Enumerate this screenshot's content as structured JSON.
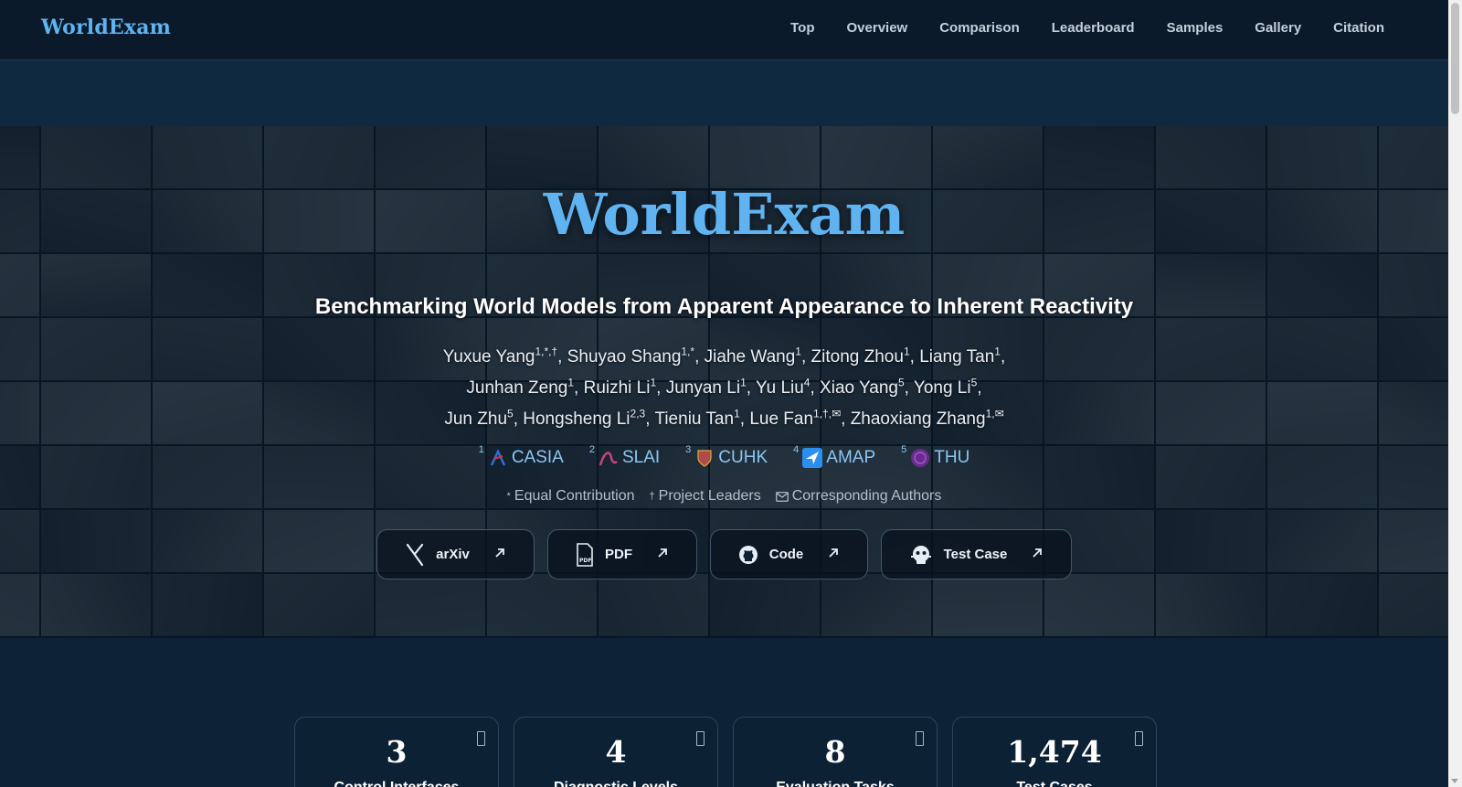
{
  "nav": {
    "brand": "WorldExam",
    "links": [
      "Top",
      "Overview",
      "Comparison",
      "Leaderboard",
      "Samples",
      "Gallery",
      "Citation"
    ]
  },
  "hero": {
    "title": "WorldExam",
    "subtitle": "Benchmarking World Models from Apparent Appearance to Inherent Reactivity",
    "author_lines": [
      [
        {
          "name": "Yuxue Yang",
          "sup": "1,*,†"
        },
        {
          "name": "Shuyao Shang",
          "sup": "1,*"
        },
        {
          "name": "Jiahe Wang",
          "sup": "1"
        },
        {
          "name": "Zitong Zhou",
          "sup": "1"
        },
        {
          "name": "Liang Tan",
          "sup": "1"
        }
      ],
      [
        {
          "name": "Junhan Zeng",
          "sup": "1"
        },
        {
          "name": "Ruizhi Li",
          "sup": "1"
        },
        {
          "name": "Junyan Li",
          "sup": "1"
        },
        {
          "name": "Yu Liu",
          "sup": "4"
        },
        {
          "name": "Xiao Yang",
          "sup": "5"
        },
        {
          "name": "Yong Li",
          "sup": "5"
        }
      ],
      [
        {
          "name": "Jun Zhu",
          "sup": "5"
        },
        {
          "name": "Hongsheng Li",
          "sup": "2,3"
        },
        {
          "name": "Tieniu Tan",
          "sup": "1"
        },
        {
          "name": "Lue Fan",
          "sup": "1,†,✉"
        },
        {
          "name": "Zhaoxiang Zhang",
          "sup": "1,✉"
        }
      ]
    ],
    "affiliations": [
      {
        "num": "1",
        "name": "CASIA",
        "icon": "casia-logo-icon",
        "color": "#2f6fd6"
      },
      {
        "num": "2",
        "name": "SLAI",
        "icon": "slai-logo-icon",
        "color": "#c2457d"
      },
      {
        "num": "3",
        "name": "CUHK",
        "icon": "cuhk-logo-icon",
        "color": "#b04a4a"
      },
      {
        "num": "4",
        "name": "AMAP",
        "icon": "amap-logo-icon",
        "color": "#2b8ff0"
      },
      {
        "num": "5",
        "name": "THU",
        "icon": "thu-logo-icon",
        "color": "#6b2a8f"
      }
    ],
    "notes": {
      "equal_mark": "*",
      "equal": "Equal Contribution",
      "leader_mark": "†",
      "leader": "Project Leaders",
      "corresponding": "Corresponding Authors"
    },
    "buttons": [
      {
        "label": "arXiv",
        "icon": "arxiv-icon"
      },
      {
        "label": "PDF",
        "icon": "pdf-icon"
      },
      {
        "label": "Code",
        "icon": "github-icon"
      },
      {
        "label": "Test Case",
        "icon": "robot-icon"
      }
    ]
  },
  "stats": [
    {
      "value": "3",
      "label": "Control Interfaces"
    },
    {
      "value": "4",
      "label": "Diagnostic Levels"
    },
    {
      "value": "8",
      "label": "Evaluation Tasks"
    },
    {
      "value": "1,474",
      "label": "Test Cases"
    }
  ],
  "colors": {
    "accent": "#5fb3f0",
    "background": "#0d2236",
    "nav_background": "#0b1a2b"
  }
}
